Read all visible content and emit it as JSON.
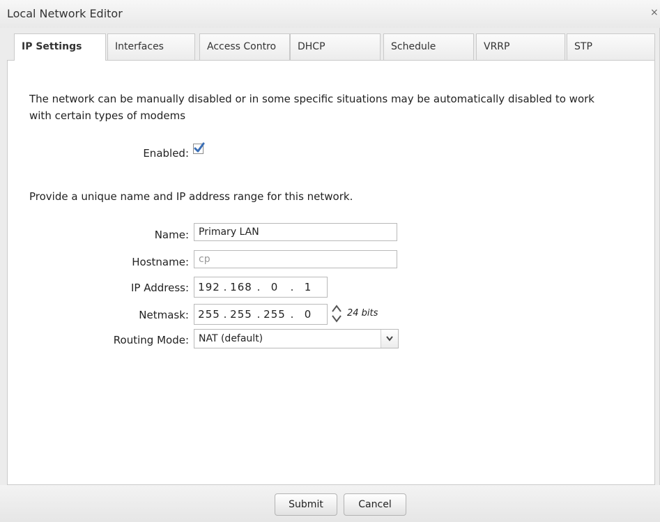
{
  "window": {
    "title": "Local Network Editor",
    "close_glyph": "×"
  },
  "tabs": [
    {
      "label": "IP Settings",
      "active": true
    },
    {
      "label": "Interfaces",
      "active": false
    },
    {
      "label": "Access Contro",
      "active": false
    },
    {
      "label": "DHCP",
      "active": false
    },
    {
      "label": "Schedule",
      "active": false
    },
    {
      "label": "VRRP",
      "active": false
    },
    {
      "label": "STP",
      "active": false
    }
  ],
  "content": {
    "description": "The network can be manually disabled or in some specific situations may be automatically disabled to work with certain types of modems",
    "enabled_label": "Enabled:",
    "enabled_checked": true,
    "range_description": "Provide a unique name and IP address range for this network.",
    "name_label": "Name:",
    "name_value": "Primary LAN",
    "hostname_label": "Hostname:",
    "hostname_placeholder": "cp",
    "ip_label": "IP Address:",
    "ip_octets": [
      "192",
      "168",
      "0",
      "1"
    ],
    "netmask_label": "Netmask:",
    "netmask_octets": [
      "255",
      "255",
      "255",
      "0"
    ],
    "netmask_bits": "24 bits",
    "routing_label": "Routing Mode:",
    "routing_value": "NAT (default)"
  },
  "buttons": {
    "submit": "Submit",
    "cancel": "Cancel"
  },
  "colors": {
    "checkbox_check": "#3b6fb6",
    "panel_bg": "#ffffff",
    "dialog_bg": "#ececec"
  }
}
